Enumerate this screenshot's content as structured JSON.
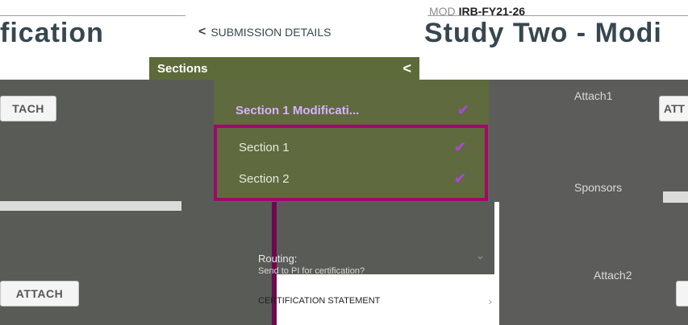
{
  "header": {
    "page_title_left": "fication",
    "page_title_right": "Study Two - Modi",
    "back_link_label": "SUBMISSION DETAILS",
    "irb_prefix": "MOD",
    "irb_code": "IRB-FY21-26"
  },
  "left_buttons": {
    "attach_top": "TACH",
    "attach_bottom": "ATTACH"
  },
  "sections_panel": {
    "title": "Sections",
    "collapse_icon": "chevron-left-icon",
    "items": [
      {
        "label": "Section 1 Modificati...",
        "checked": true
      },
      {
        "label": "Section 1",
        "checked": true
      },
      {
        "label": "Section 2",
        "checked": true
      }
    ]
  },
  "routing": {
    "label": "Routing:",
    "question": "Send to PI for certification?",
    "select_value": "CERTIFICATION STATEMENT"
  },
  "right_panel": {
    "attach1_label": "Attach1",
    "attach_button": "ATT",
    "sponsors_label": "Sponsors",
    "attach2_label": "Attach2"
  },
  "colors": {
    "olive": "#5f6a3f",
    "highlight": "#a0086b",
    "check": "#a64ac9",
    "overlay": "#595b57"
  }
}
